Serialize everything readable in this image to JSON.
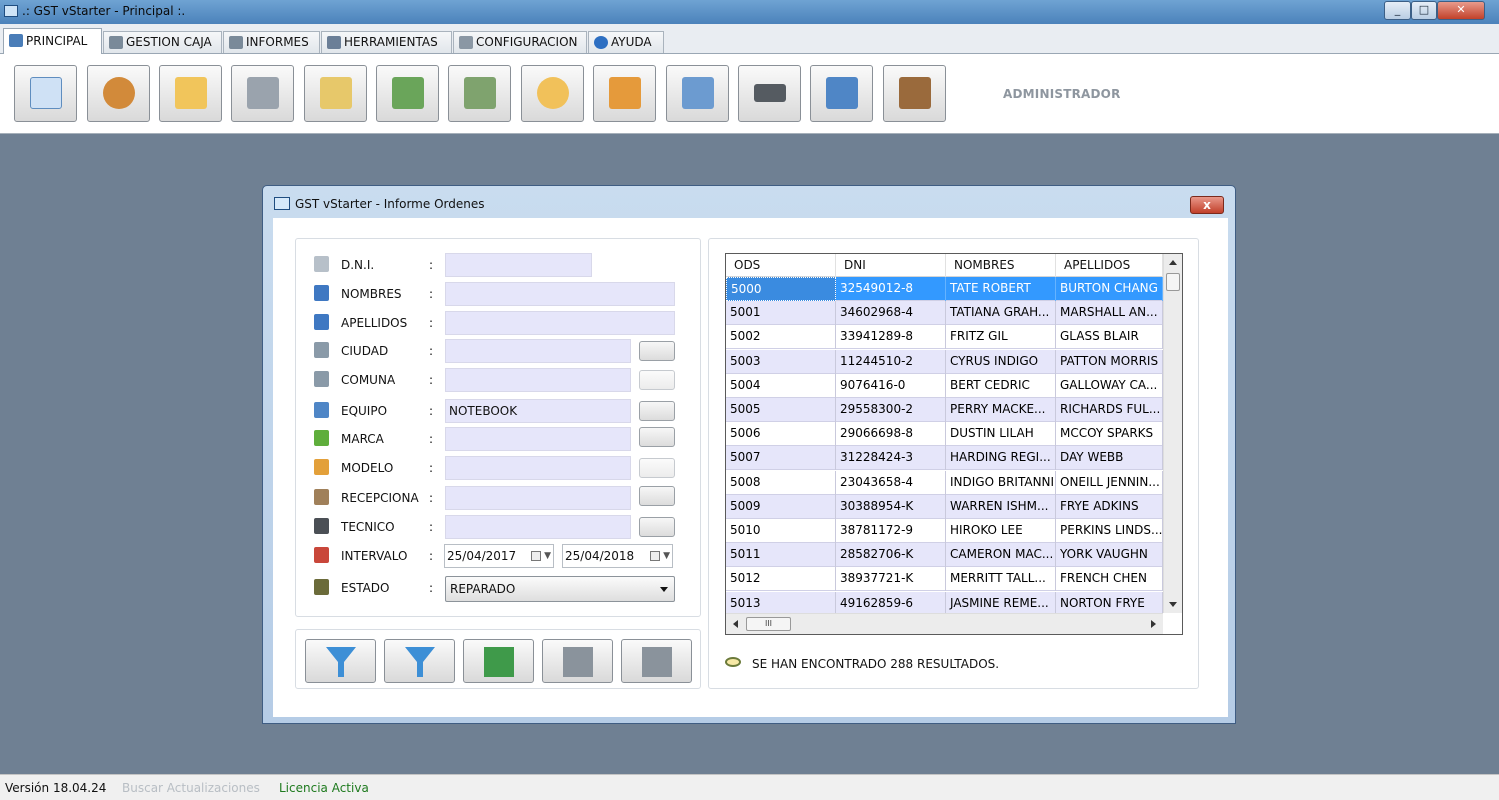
{
  "window": {
    "title": ".: GST vStarter - Principal :."
  },
  "tabs": [
    {
      "label": "PRINCIPAL",
      "icon": "home-icon",
      "color": "#4a7db8"
    },
    {
      "label": "GESTION CAJA",
      "icon": "cash-register-icon",
      "color": "#7a8a99"
    },
    {
      "label": "INFORMES",
      "icon": "printer-icon",
      "color": "#7a8a99"
    },
    {
      "label": "HERRAMIENTAS",
      "icon": "tools-icon",
      "color": "#6b7f97"
    },
    {
      "label": "CONFIGURACION",
      "icon": "settings-icon",
      "color": "#8a97a4"
    },
    {
      "label": "AYUDA",
      "icon": "help-icon",
      "color": "#2d6fc2"
    }
  ],
  "toolbar": {
    "admin_label": "ADMINISTRADOR",
    "buttons": [
      {
        "name": "new-document-icon",
        "color": "#cfe1f5"
      },
      {
        "name": "users-icon",
        "color": "#d28a3a"
      },
      {
        "name": "open-folder-icon",
        "color": "#f1c55b"
      },
      {
        "name": "printer-icon",
        "color": "#9aa3ad"
      },
      {
        "name": "search-document-icon",
        "color": "#e7c86a"
      },
      {
        "name": "money-add-icon",
        "color": "#6aa55a"
      },
      {
        "name": "money-remove-icon",
        "color": "#7fa36e"
      },
      {
        "name": "chat-icon",
        "color": "#f1c15a"
      },
      {
        "name": "delivery-truck-icon",
        "color": "#e59a3b"
      },
      {
        "name": "id-card-icon",
        "color": "#6c9bd0"
      },
      {
        "name": "gun-icon",
        "color": "#555b61"
      },
      {
        "name": "computer-key-icon",
        "color": "#4f86c6"
      },
      {
        "name": "exit-door-icon",
        "color": "#9a6a3c"
      }
    ]
  },
  "dialog": {
    "title": "GST vStarter - Informe Ordenes",
    "close_label": "x"
  },
  "form": {
    "colon": ":",
    "dni": {
      "label": "D.N.I.",
      "value": ""
    },
    "nombres": {
      "label": "NOMBRES",
      "value": ""
    },
    "apellidos": {
      "label": "APELLIDOS",
      "value": ""
    },
    "ciudad": {
      "label": "CIUDAD",
      "value": ""
    },
    "comuna": {
      "label": "COMUNA",
      "value": ""
    },
    "equipo": {
      "label": "EQUIPO",
      "value": "NOTEBOOK"
    },
    "marca": {
      "label": "MARCA",
      "value": ""
    },
    "modelo": {
      "label": "MODELO",
      "value": ""
    },
    "recepciona": {
      "label": "RECEPCIONA",
      "value": ""
    },
    "tecnico": {
      "label": "TECNICO",
      "value": ""
    },
    "intervalo": {
      "label": "INTERVALO",
      "from": "25/04/2017",
      "to": "25/04/2018"
    },
    "estado": {
      "label": "ESTADO",
      "value": "REPARADO"
    }
  },
  "actions": [
    {
      "name": "filter-button",
      "icon": "funnel-icon",
      "color": "#3d8fd6"
    },
    {
      "name": "clear-filter-button",
      "icon": "funnel-clear-icon",
      "color": "#3d8fd6"
    },
    {
      "name": "export-excel-button",
      "icon": "excel-export-icon",
      "color": "#3f9a4a"
    },
    {
      "name": "print-button",
      "icon": "printer-icon",
      "color": "#8a939c"
    },
    {
      "name": "print-detail-button",
      "icon": "printer-icon",
      "color": "#8a939c"
    }
  ],
  "grid": {
    "columns": [
      "ODS",
      "DNI",
      "NOMBRES",
      "APELLIDOS"
    ],
    "rows": [
      [
        "5000",
        "32549012-8",
        "TATE ROBERT",
        "BURTON CHANG"
      ],
      [
        "5001",
        "34602968-4",
        "TATIANA GRAH...",
        "MARSHALL AN..."
      ],
      [
        "5002",
        "33941289-8",
        "FRITZ GIL",
        "GLASS BLAIR"
      ],
      [
        "5003",
        "11244510-2",
        "CYRUS INDIGO",
        "PATTON MORRIS"
      ],
      [
        "5004",
        "9076416-0",
        "BERT CEDRIC",
        "GALLOWAY CA..."
      ],
      [
        "5005",
        "29558300-2",
        "PERRY MACKE...",
        "RICHARDS FUL..."
      ],
      [
        "5006",
        "29066698-8",
        "DUSTIN LILAH",
        "MCCOY SPARKS"
      ],
      [
        "5007",
        "31228424-3",
        "HARDING REGI...",
        "DAY WEBB"
      ],
      [
        "5008",
        "23043658-4",
        "INDIGO BRITANNI",
        "ONEILL JENNIN..."
      ],
      [
        "5009",
        "30388954-K",
        "WARREN ISHM...",
        "FRYE ADKINS"
      ],
      [
        "5010",
        "38781172-9",
        "HIROKO LEE",
        "PERKINS LINDS..."
      ],
      [
        "5011",
        "28582706-K",
        "CAMERON MAC...",
        "YORK VAUGHN"
      ],
      [
        "5012",
        "38937721-K",
        "MERRITT TALL...",
        "FRENCH CHEN"
      ],
      [
        "5013",
        "49162859-6",
        "JASMINE REME...",
        "NORTON FRYE"
      ]
    ],
    "scroll_grip": "III",
    "results_text": "SE HAN ENCONTRADO 288 RESULTADOS."
  },
  "status": {
    "version": "Versión 18.04.24",
    "update": "Buscar Actualizaciones",
    "license": "Licencia Activa"
  }
}
